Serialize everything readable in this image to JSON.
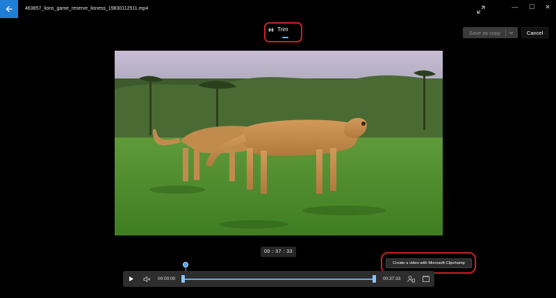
{
  "window": {
    "file_name": "463857_lions_game_reserve_lioness_19830112511.mp4",
    "back_icon": "back-arrow-icon",
    "expand_icon": "expand-icon",
    "minimize_glyph": "—",
    "maximize_glyph": "☐",
    "close_glyph": "✕"
  },
  "toolbar": {
    "trim_label": "Trim",
    "trim_icon": "trim-icon",
    "save_as_copy_label": "Save as copy",
    "cancel_label": "Cancel"
  },
  "player": {
    "timestamp_display": "00 : 37 : 33",
    "start_time": "00:00:00",
    "end_time": "00:37:33",
    "clipchamp_tooltip": "Create a video with Microsoft Clipchamp",
    "icons": [
      "play-icon",
      "mute-icon",
      "people-icon",
      "clipchamp-icon"
    ]
  },
  "colors": {
    "accent": "#1f7fd6",
    "track": "#6aa9e8",
    "highlight": "#d0202a"
  }
}
